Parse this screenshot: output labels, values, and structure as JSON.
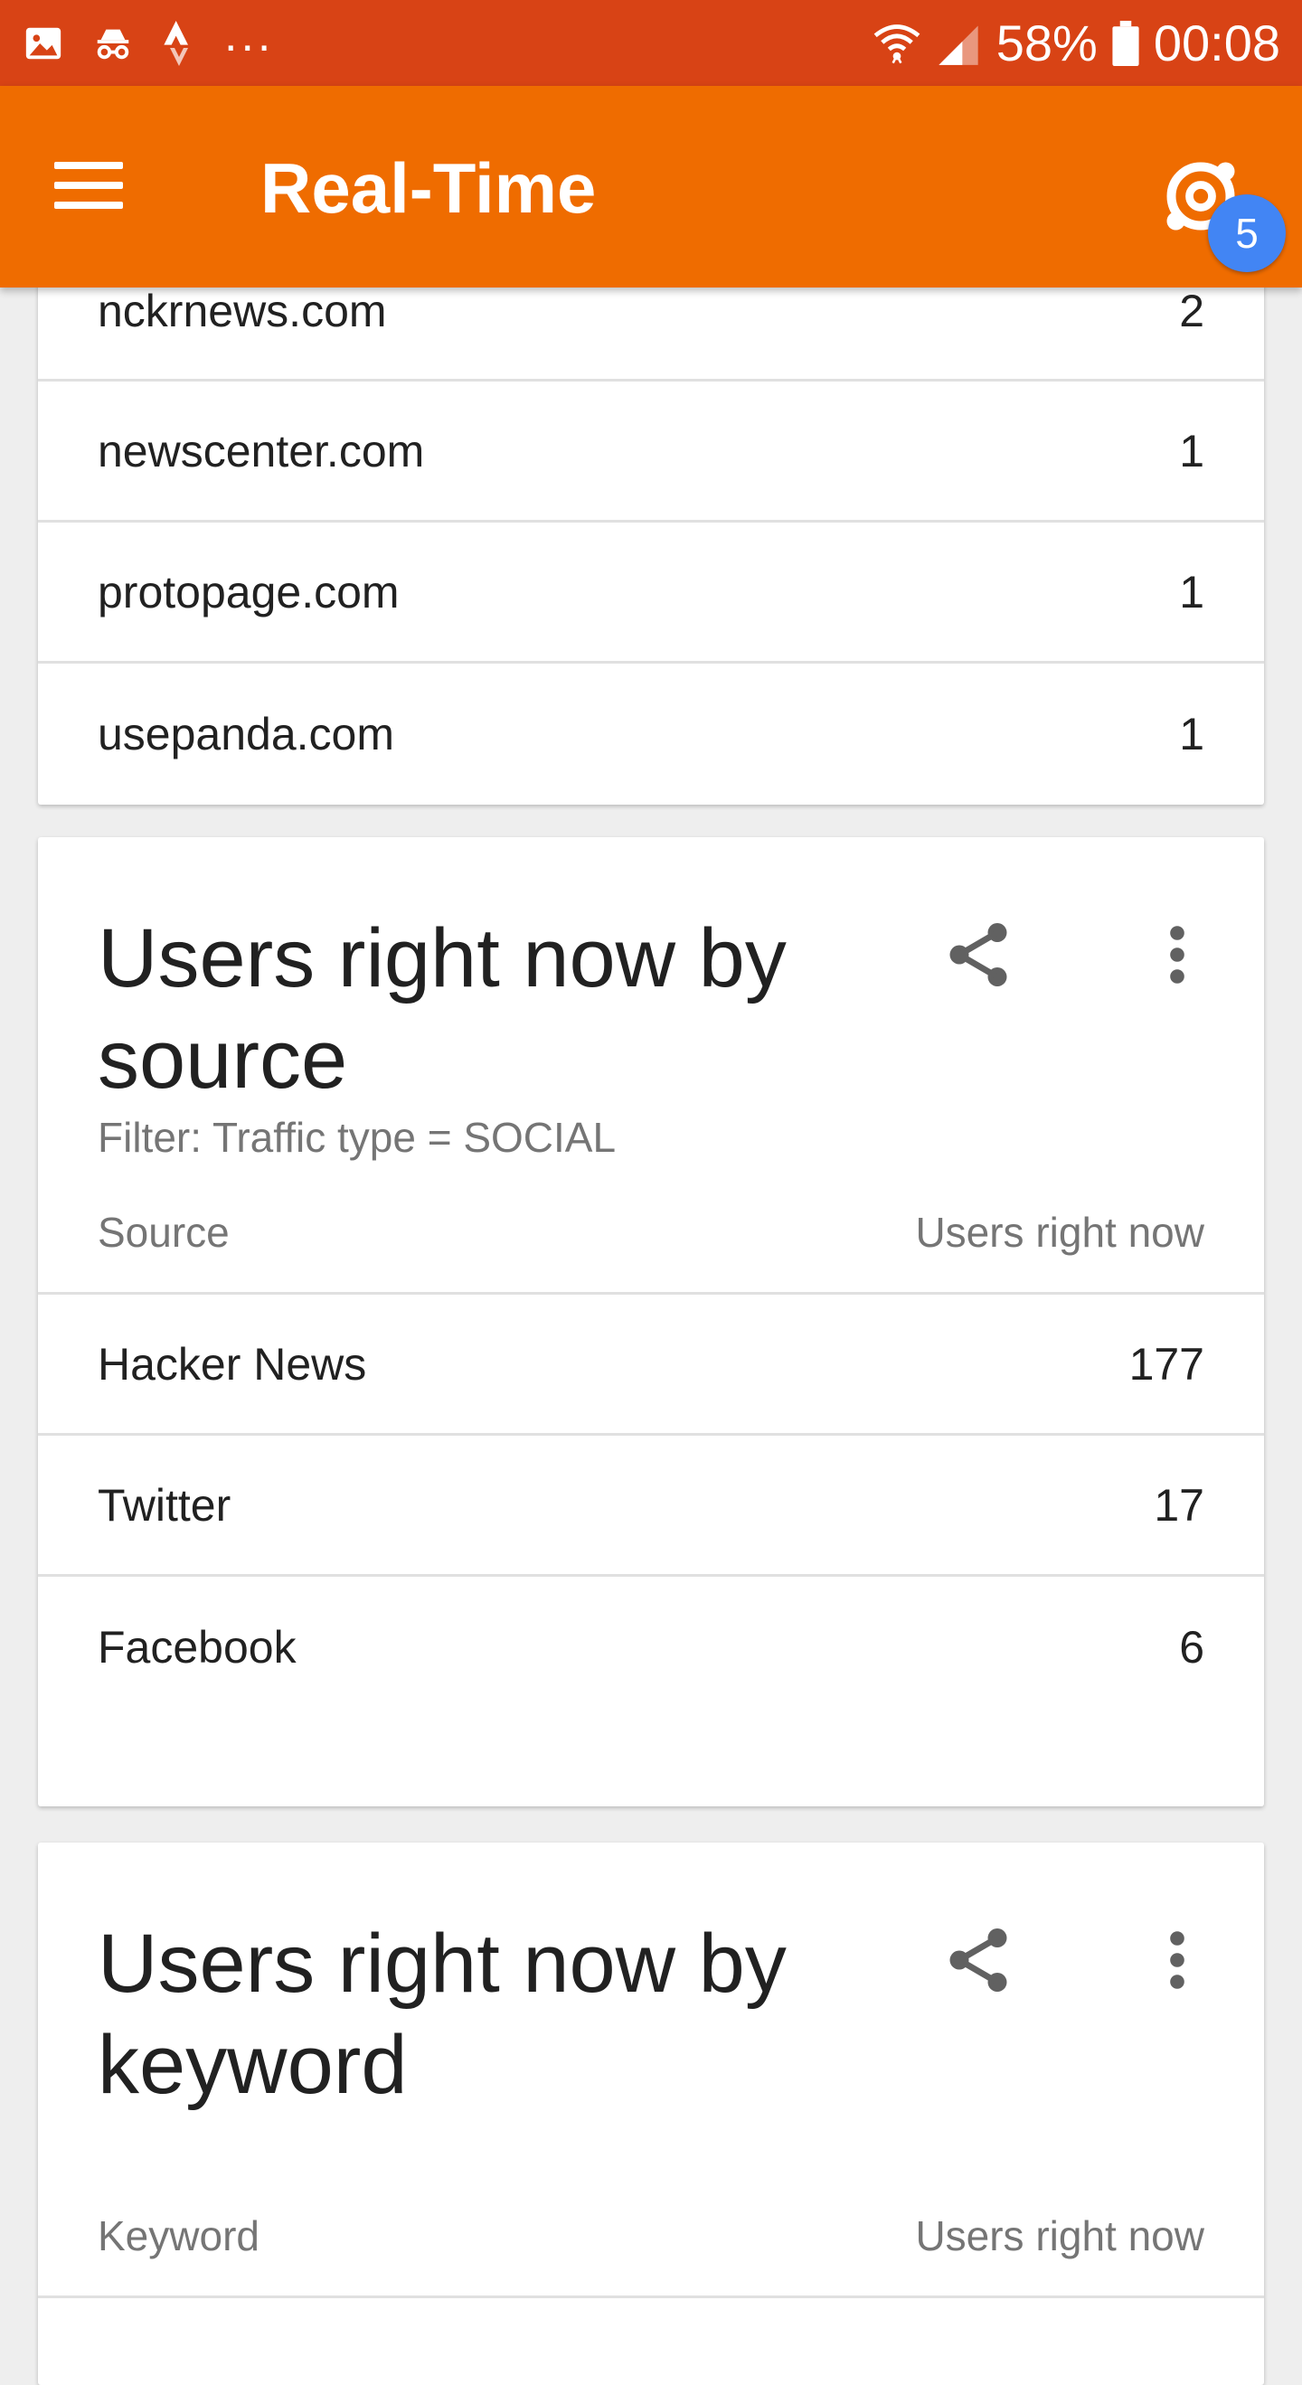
{
  "status_bar": {
    "battery": "58%",
    "time": "00:08",
    "more_notifications": "...",
    "icons": [
      "image-icon",
      "incognito-icon",
      "strava-icon",
      "wifi-icon",
      "signal-icon",
      "battery-icon"
    ]
  },
  "app_bar": {
    "title": "Real-Time",
    "badge_count": "5",
    "color": "#ef6c00",
    "status_color": "#d84315",
    "badge_color": "#4285f4",
    "icons": [
      "menu-icon",
      "realtime-icon"
    ]
  },
  "referrals": {
    "rows": [
      {
        "name": "nckrnews.com",
        "value": "2"
      },
      {
        "name": "newscenter.com",
        "value": "1"
      },
      {
        "name": "protopage.com",
        "value": "1"
      },
      {
        "name": "usepanda.com",
        "value": "1"
      }
    ]
  },
  "source_card": {
    "title": "Users right now by source",
    "filter": "Filter: Traffic type = SOCIAL",
    "col_left": "Source",
    "col_right": "Users right now",
    "rows": [
      {
        "name": "Hacker News",
        "value": "177"
      },
      {
        "name": "Twitter",
        "value": "17"
      },
      {
        "name": "Facebook",
        "value": "6"
      }
    ],
    "icons": [
      "share-icon",
      "more-vert-icon"
    ]
  },
  "keyword_card": {
    "title": "Users right now by keyword",
    "col_left": "Keyword",
    "col_right": "Users right now",
    "icons": [
      "share-icon",
      "more-vert-icon"
    ]
  }
}
